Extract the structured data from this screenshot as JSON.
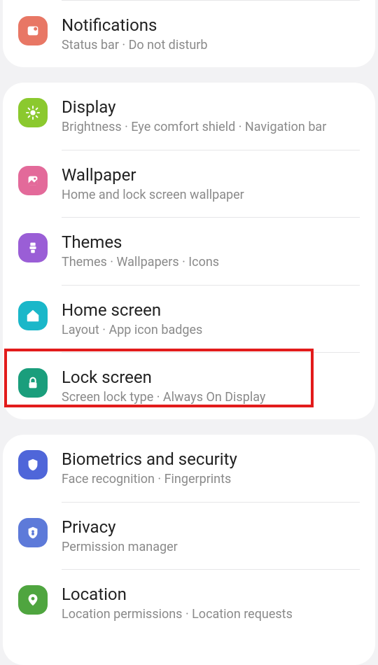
{
  "card1": {
    "notifications": {
      "title": "Notifications",
      "sub": "Status bar  ·  Do not disturb",
      "color": "#e87765"
    }
  },
  "card2": {
    "display": {
      "title": "Display",
      "sub": "Brightness  ·  Eye comfort shield  ·  Navigation bar",
      "color": "#8bc92e"
    },
    "wallpaper": {
      "title": "Wallpaper",
      "sub": "Home and lock screen wallpaper",
      "color": "#e36a9a"
    },
    "themes": {
      "title": "Themes",
      "sub": "Themes  ·  Wallpapers  ·  Icons",
      "color": "#9a5ed6"
    },
    "home": {
      "title": "Home screen",
      "sub": "Layout  ·  App icon badges",
      "color": "#1ab7c9"
    },
    "lock": {
      "title": "Lock screen",
      "sub": "Screen lock type  ·  Always On Display",
      "color": "#1a9e7c"
    }
  },
  "card3": {
    "biometrics": {
      "title": "Biometrics and security",
      "sub": "Face recognition  ·  Fingerprints",
      "color": "#4f66d9"
    },
    "privacy": {
      "title": "Privacy",
      "sub": "Permission manager",
      "color": "#5d7ad9"
    },
    "location": {
      "title": "Location",
      "sub": "Location permissions  ·  Location requests",
      "color": "#4fa53f"
    }
  }
}
